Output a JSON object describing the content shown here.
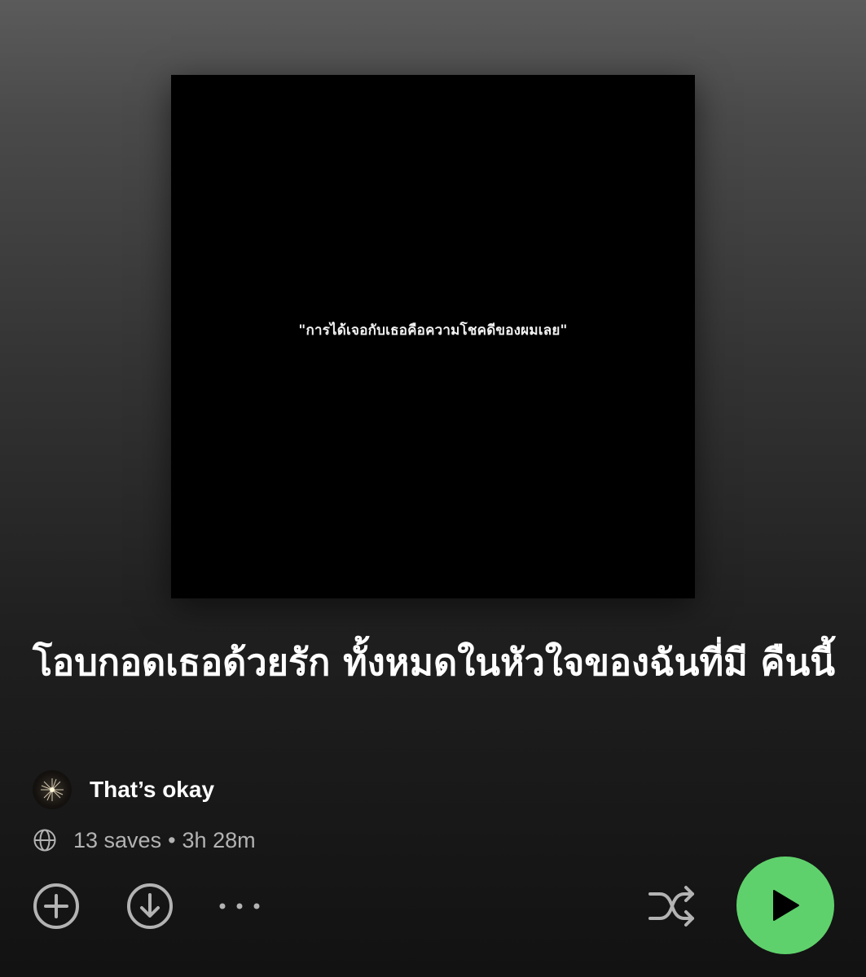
{
  "playlist": {
    "cover_quote": "\"การได้เจอกับเธอคือความโชคดีของผมเลย\"",
    "title": "โอบกอดเธอด้วยรัก ทั้งหมดในหัวใจของฉันที่มี คืนนี้",
    "owner_name": "That’s okay",
    "saves": "13 saves",
    "separator": "•",
    "duration": "3h 28m"
  },
  "icons": {
    "privacy": "globe-icon",
    "add": "add-circle-icon",
    "download": "download-circle-icon",
    "more": "more-dots-icon",
    "shuffle": "shuffle-icon",
    "play": "play-icon"
  },
  "colors": {
    "accent": "#5fd16c",
    "text_primary": "#ffffff",
    "text_secondary": "#b3b3b3"
  }
}
